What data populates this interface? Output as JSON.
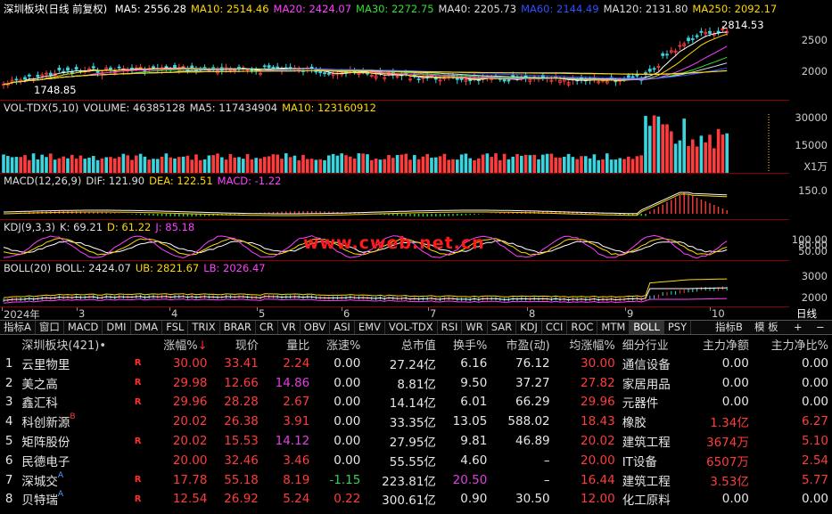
{
  "chart_header": {
    "title": "深圳板块(日线 前复权)",
    "ma": [
      {
        "label": "MA5: 2556.28",
        "color": "#ffffff"
      },
      {
        "label": "MA10: 2514.46",
        "color": "#ffd800"
      },
      {
        "label": "MA20: 2424.07",
        "color": "#ff40ff"
      },
      {
        "label": "MA30: 2272.75",
        "color": "#33dd33"
      },
      {
        "label": "MA40: 2205.73",
        "color": "#dddddd"
      },
      {
        "label": "MA60: 2144.49",
        "color": "#3050ff"
      },
      {
        "label": "MA120: 2131.80",
        "color": "#dddddd"
      },
      {
        "label": "MA250: 2092.17",
        "color": "#ffd800"
      }
    ],
    "high_label": "2814.53",
    "low_label": "1748.85",
    "axis": [
      "2500",
      "2000"
    ]
  },
  "volume_header": {
    "items": [
      {
        "label": "VOL-TDX(5,10)",
        "color": "#dddddd"
      },
      {
        "label": "VOLUME: 46385128",
        "color": "#dddddd"
      },
      {
        "label": "MA5: 117434904",
        "color": "#dddddd"
      },
      {
        "label": "MA10: 123160912",
        "color": "#ffd800"
      }
    ],
    "axis": [
      "30000",
      "15000",
      "X1万"
    ]
  },
  "macd_header": {
    "items": [
      {
        "label": "MACD(12,26,9)",
        "color": "#dddddd"
      },
      {
        "label": "DIF: 121.90",
        "color": "#dddddd"
      },
      {
        "label": "DEA: 122.51",
        "color": "#ffd800"
      },
      {
        "label": "MACD: -1.22",
        "color": "#ff40ff"
      }
    ],
    "axis": [
      "150.0"
    ]
  },
  "kdj_header": {
    "items": [
      {
        "label": "KDJ(9,3,3)",
        "color": "#dddddd"
      },
      {
        "label": "K: 69.21",
        "color": "#dddddd"
      },
      {
        "label": "D: 61.22",
        "color": "#ffd800"
      },
      {
        "label": "J: 85.18",
        "color": "#ff40ff"
      }
    ],
    "axis": [
      "100.00",
      "80.00",
      "50.00"
    ]
  },
  "boll_header": {
    "items": [
      {
        "label": "BOLL(20)",
        "color": "#dddddd"
      },
      {
        "label": "BOLL: 2424.07",
        "color": "#dddddd"
      },
      {
        "label": "UB: 2821.67",
        "color": "#ffd800"
      },
      {
        "label": "LB: 2026.47",
        "color": "#ff40ff"
      }
    ],
    "axis": [
      "3000",
      "2000"
    ]
  },
  "watermark": "www.cweb.net.cn",
  "time_axis": {
    "labels": [
      "2024年",
      "3",
      "4",
      "5",
      "6",
      "7",
      "8",
      "9",
      "10"
    ],
    "period": "日线"
  },
  "tabs": [
    "指标A",
    "窗口",
    "MACD",
    "DMI",
    "DMA",
    "FSL",
    "TRIX",
    "BRAR",
    "CR",
    "VR",
    "OBV",
    "ASI",
    "EMV",
    "VOL-TDX",
    "RSI",
    "WR",
    "SAR",
    "KDJ",
    "CCI",
    "ROC",
    "MTM",
    "BOLL",
    "PSY"
  ],
  "active_tab": "BOLL",
  "tab_right": {
    "indicator_b": "指标B",
    "template": "模 板",
    "plus": "+",
    "minus": "−"
  },
  "table": {
    "columns": [
      "",
      "深圳板块(421)•",
      "",
      "涨幅%↓",
      "现价",
      "量比",
      "涨速%",
      "总市值",
      "换手%",
      "市盈(动)",
      "均涨幅%",
      "细分行业",
      "主力净额",
      "主力净比%"
    ],
    "rows": [
      {
        "idx": "1",
        "name": "云里物里",
        "sup": "",
        "r": "R",
        "chg": "30.00",
        "price": "33.41",
        "vr": "2.24",
        "spd": "0.00",
        "mcap": "27.24亿",
        "turn": "6.16",
        "pe": "76.12",
        "avg": "30.00",
        "ind": "通信设备",
        "net": "0.00",
        "netpct": "0.00"
      },
      {
        "idx": "2",
        "name": "美之高",
        "sup": "",
        "r": "R",
        "chg": "29.98",
        "price": "12.66",
        "vr": "14.86",
        "spd": "0.00",
        "mcap": "8.81亿",
        "turn": "9.50",
        "pe": "37.27",
        "avg": "27.82",
        "ind": "家居用品",
        "net": "0.00",
        "netpct": "0.00"
      },
      {
        "idx": "3",
        "name": "鑫汇科",
        "sup": "",
        "r": "R",
        "chg": "29.96",
        "price": "28.28",
        "vr": "2.67",
        "spd": "0.00",
        "mcap": "14.14亿",
        "turn": "6.01",
        "pe": "66.29",
        "avg": "29.96",
        "ind": "元器件",
        "net": "0.00",
        "netpct": "0.00"
      },
      {
        "idx": "4",
        "name": "科创新源",
        "sup": "B",
        "r": "",
        "chg": "20.02",
        "price": "26.38",
        "vr": "3.91",
        "spd": "0.00",
        "mcap": "33.35亿",
        "turn": "13.05",
        "pe": "588.02",
        "avg": "18.43",
        "ind": "橡胶",
        "net": "1.34亿",
        "netpct": "6.27"
      },
      {
        "idx": "5",
        "name": "矩阵股份",
        "sup": "",
        "r": "R",
        "chg": "20.02",
        "price": "15.53",
        "vr": "14.12",
        "spd": "0.00",
        "mcap": "27.95亿",
        "turn": "9.81",
        "pe": "46.89",
        "avg": "20.02",
        "ind": "建筑工程",
        "net": "3674万",
        "netpct": "5.10"
      },
      {
        "idx": "6",
        "name": "民德电子",
        "sup": "",
        "r": "",
        "chg": "20.00",
        "price": "32.46",
        "vr": "3.46",
        "spd": "0.00",
        "mcap": "55.55亿",
        "turn": "4.60",
        "pe": "–",
        "avg": "20.00",
        "ind": "IT设备",
        "net": "6507万",
        "netpct": "2.54"
      },
      {
        "idx": "7",
        "name": "深城交",
        "sup": "A",
        "r": "R",
        "chg": "17.78",
        "price": "55.18",
        "vr": "8.19",
        "spd": "-1.15",
        "mcap": "223.81亿",
        "turn": "20.50",
        "pe": "–",
        "avg": "16.44",
        "ind": "建筑工程",
        "net": "3.53亿",
        "netpct": "5.77"
      },
      {
        "idx": "8",
        "name": "贝特瑞",
        "sup": "A",
        "r": "R",
        "chg": "12.54",
        "price": "26.92",
        "vr": "5.24",
        "spd": "0.22",
        "mcap": "300.61亿",
        "turn": "0.90",
        "pe": "30.50",
        "avg": "12.00",
        "ind": "化工原料",
        "net": "0.00",
        "netpct": "0.00"
      }
    ]
  }
}
